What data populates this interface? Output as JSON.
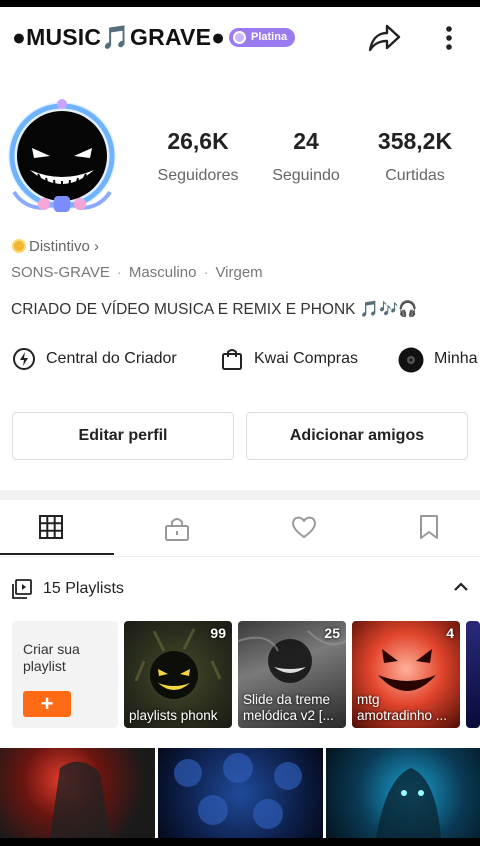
{
  "header": {
    "title": "●MUSIC🎵GRAVE●",
    "badge": "Platina",
    "share_icon": "share-arrow-icon",
    "more_icon": "vertical-dots-icon"
  },
  "profile": {
    "avatar_icon": "grinning-demon-avatar-icon",
    "stats": [
      {
        "value": "26,6K",
        "label": "Seguidores"
      },
      {
        "value": "24",
        "label": "Seguindo"
      },
      {
        "value": "358,2K",
        "label": "Curtidas"
      }
    ],
    "distintivo": "Distintivo",
    "chevron": "›",
    "meta": {
      "category": "SONS-GRAVE",
      "gender": "Masculino",
      "sign": "Virgem",
      "separator": "·"
    },
    "bio": "CRIADO DE VÍDEO MUSICA E REMIX  E PHONK 🎵🎶🎧"
  },
  "links": {
    "creator_center": "Central do Criador",
    "shopping": "Kwai Compras",
    "mine": "Minha"
  },
  "buttons": {
    "edit_profile": "Editar perfil",
    "add_friends": "Adicionar amigos"
  },
  "tabs": {
    "icons": [
      "grid-icon",
      "lock-icon",
      "heart-icon",
      "bookmark-icon"
    ],
    "active_index": 0
  },
  "playlists": {
    "header": "15 Playlists",
    "create_label": "Criar sua playlist",
    "create_button": "+",
    "items": [
      {
        "count": "99",
        "name": "playlists phonk"
      },
      {
        "count": "25",
        "name": "Slide da treme melódica v2 [..."
      },
      {
        "count": "4",
        "name": "mtg amotradinho ..."
      }
    ]
  },
  "colors": {
    "accent": "#ff6a14",
    "badge": "#9b7cf0",
    "text": "#222222",
    "muted": "#777777"
  }
}
